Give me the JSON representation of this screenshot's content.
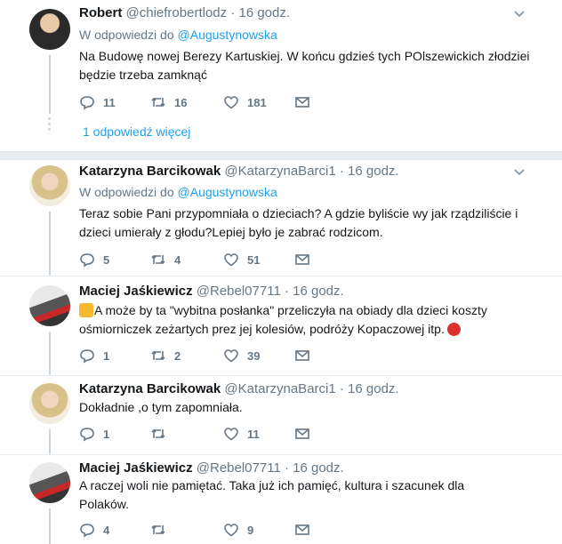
{
  "tweets": [
    {
      "name": "Robert",
      "handle": "@chiefrobertlodz",
      "time": "16 godz.",
      "reply_prefix": "W odpowiedzi do",
      "reply_to": "@Augustynowska",
      "text_lines": [
        "Na Budowę nowej Berezy Kartuskiej. W końcu gdzieś tych POlszewickich złodziei",
        "będzie trzeba zamknąć"
      ],
      "replies": "11",
      "retweets": "16",
      "likes": "181",
      "more_replies": "1 odpowiedź więcej"
    },
    {
      "name": "Katarzyna Barcikowak",
      "handle": "@KatarzynaBarci1",
      "time": "16 godz.",
      "reply_prefix": "W odpowiedzi do",
      "reply_to": "@Augustynowska",
      "text_lines": [
        "Teraz sobie Pani przypomniała o dzieciach? A gdzie byliście wy jak rządziliście i",
        "dzieci umierały z głodu?Lepiej było je zabrać rodzicom."
      ],
      "replies": "5",
      "retweets": "4",
      "likes": "51"
    },
    {
      "name": "Maciej Jaśkiewicz",
      "handle": "@Rebel07711",
      "time": "16 godz.",
      "text_lines": [
        "A może by ta \"wybitna posłanka\" przeliczyła na obiady dla dzieci koszty",
        "ośmiorniczek zeżartych prez jej kolesiów, podróży Kopaczowej itp."
      ],
      "replies": "1",
      "retweets": "2",
      "likes": "39"
    },
    {
      "name": "Katarzyna Barcikowak",
      "handle": "@KatarzynaBarci1",
      "time": "16 godz.",
      "text_lines": [
        "Dokładnie ,o tym zapomniała."
      ],
      "replies": "1",
      "retweets": "",
      "likes": "11"
    },
    {
      "name": "Maciej Jaśkiewicz",
      "handle": "@Rebel07711",
      "time": "16 godz.",
      "text_lines": [
        "A raczej woli nie pamiętać. Taka już ich pamięć, kultura i szacunek dla",
        "Polaków."
      ],
      "replies": "4",
      "retweets": "",
      "likes": "9"
    }
  ],
  "icons": {
    "reply": "reply-icon",
    "retweet": "retweet-icon",
    "like": "heart-icon",
    "dm": "envelope-icon",
    "menu": "chevron-down-icon"
  },
  "colors": {
    "link": "#1da1f2",
    "muted": "#657786",
    "divider": "#e6ecf0"
  }
}
